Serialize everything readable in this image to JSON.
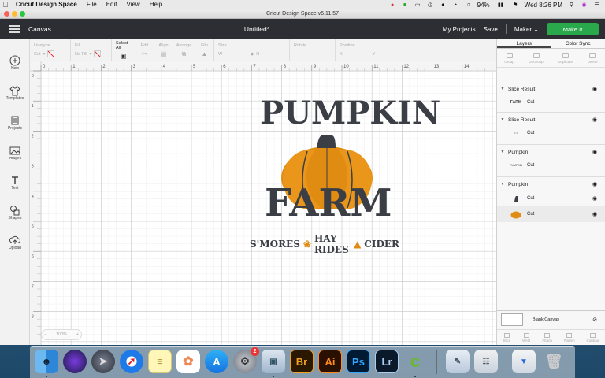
{
  "menubar": {
    "app_name": "Cricut Design Space",
    "items": [
      "File",
      "Edit",
      "View",
      "Help"
    ],
    "battery": "94%",
    "clock": "Wed 8:26 PM"
  },
  "window": {
    "title": "Cricut Design Space  v5.11.57"
  },
  "topbar": {
    "section": "Canvas",
    "doc_title": "Untitled*",
    "my_projects": "My Projects",
    "save": "Save",
    "machine": "Maker",
    "make_it": "Make It"
  },
  "editbar": {
    "linetype_label": "Linetype",
    "linetype_value": "Cut",
    "fill_label": "Fill",
    "fill_value": "No Fill",
    "select_all": "Select All",
    "edit": "Edit",
    "align": "Align",
    "arrange": "Arrange",
    "flip": "Flip",
    "size": "Size",
    "w": "W",
    "h": "H",
    "rotate": "Rotate",
    "position": "Position",
    "x": "X",
    "y": "Y"
  },
  "lefttools": [
    {
      "label": "New",
      "icon": "plus-icon"
    },
    {
      "label": "Templates",
      "icon": "shirt-icon"
    },
    {
      "label": "Projects",
      "icon": "projects-icon"
    },
    {
      "label": "Images",
      "icon": "image-icon"
    },
    {
      "label": "Text",
      "icon": "text-icon"
    },
    {
      "label": "Shapes",
      "icon": "shapes-icon"
    },
    {
      "label": "Upload",
      "icon": "upload-icon"
    }
  ],
  "ruler": {
    "top": [
      "0",
      "1",
      "2",
      "3",
      "4",
      "5",
      "6",
      "7",
      "8",
      "9",
      "10",
      "11",
      "12",
      "13",
      "14"
    ],
    "left": [
      "0",
      "1",
      "2",
      "3",
      "4",
      "5",
      "6",
      "7",
      "8"
    ]
  },
  "design": {
    "line1": "PUMPKIN",
    "line2": "FARM",
    "line3a": "S'MORES",
    "line3b": "HAY RIDES",
    "line3c": "CIDER",
    "text_color": "#3b3f45",
    "pumpkin_color": "#e08c12",
    "stem_color": "#3b3f45"
  },
  "zoom": "100%",
  "panel": {
    "tab_layers": "Layers",
    "tab_color_sync": "Color Sync",
    "actions": [
      "Group",
      "UnGroup",
      "Duplicate",
      "Delete"
    ],
    "layers": [
      {
        "title": "Slice Result",
        "rows": [
          {
            "label": "Cut",
            "thumb": "FARM"
          }
        ]
      },
      {
        "title": "Slice Result",
        "rows": [
          {
            "label": "Cut",
            "thumb": "• •"
          }
        ]
      },
      {
        "title": "Pumpkin",
        "rows": [
          {
            "label": "Cut",
            "thumb": "PUMPKIN"
          }
        ]
      },
      {
        "title": "Pumpkin",
        "rows": [
          {
            "label": "Cut",
            "thumb": "stem"
          },
          {
            "label": "Cut",
            "thumb": "pumpkin"
          }
        ]
      }
    ],
    "blank_canvas": "Blank Canvas",
    "bottom_actions": [
      "Slice",
      "Weld",
      "Attach",
      "Flatten",
      "Contour"
    ]
  },
  "dock": {
    "ps_label": "Ps",
    "ai_label": "Ai",
    "br_label": "Br",
    "lr_label": "Lr",
    "badge_count": "2"
  }
}
